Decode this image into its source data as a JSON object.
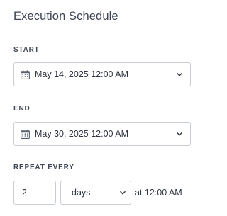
{
  "title": "Execution Schedule",
  "start": {
    "label": "START",
    "value": "May 14, 2025 12:00 AM",
    "icon": "calendar-icon"
  },
  "end": {
    "label": "END",
    "value": "May 30, 2025 12:00 AM",
    "icon": "calendar-icon"
  },
  "repeat": {
    "label": "REPEAT EVERY",
    "interval": "2",
    "unit": "days",
    "time_text": "at 12:00 AM"
  },
  "colors": {
    "text": "#2f3441",
    "border": "#c8ccd3",
    "title": "#3c4456"
  }
}
